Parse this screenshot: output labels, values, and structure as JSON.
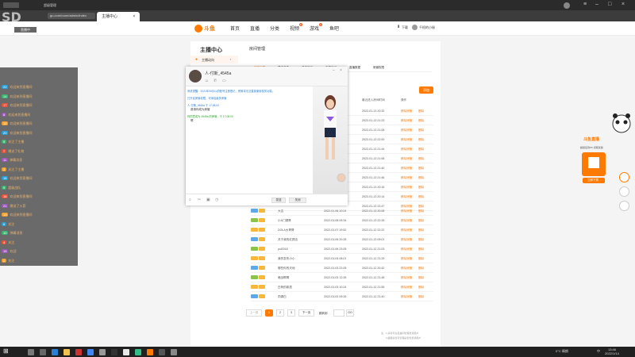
{
  "browser": {
    "tab1": "超级管理",
    "tab2": "主播中心",
    "address": "gu.com/room/admin/index"
  },
  "header": {
    "nav": [
      "首页",
      "直播",
      "分类",
      "视频",
      "游戏",
      "鱼吧"
    ],
    "video_badge": "6",
    "game_badge": "9",
    "download": "下载",
    "user": "千桓的小秘"
  },
  "overlay": {
    "logo": "SD",
    "logo_sub": "直播中",
    "chat": [
      {
        "lv": "22",
        "text": "欢迎来到直播间"
      },
      {
        "lv": "14",
        "text": "欢迎来到直播间"
      },
      {
        "lv": "17",
        "text": "欢迎来到直播间"
      },
      {
        "lv": "8",
        "text": "欢迎来到直播间"
      },
      {
        "lv": "12",
        "text": "欢迎来到直播间"
      },
      {
        "lv": "20",
        "text": "欢迎来到直播间"
      },
      {
        "lv": "5",
        "text": "关注了主播"
      },
      {
        "lv": "7",
        "text": "赠送了礼物"
      },
      {
        "lv": "11",
        "text": "弹幕消息"
      },
      {
        "lv": "3",
        "text": "关注了主播"
      },
      {
        "lv": "18",
        "text": "欢迎来到直播间"
      },
      {
        "lv": "9",
        "text": "超级战队"
      },
      {
        "lv": "16",
        "text": "欢迎来到直播间"
      },
      {
        "lv": "21",
        "text": "赠送了火箭"
      },
      {
        "lv": "13",
        "text": "欢迎来到直播间"
      },
      {
        "lv": "6",
        "text": "关注"
      },
      {
        "lv": "10",
        "text": "弹幕消息"
      },
      {
        "lv": "4",
        "text": "关注"
      },
      {
        "lv": "15",
        "text": "欢迎"
      },
      {
        "lv": "2",
        "text": "关注"
      }
    ]
  },
  "sidebar": {
    "title": "主播中心",
    "item1": "主播动向",
    "items": [
      "房间管理",
      "直播设置",
      "数据中心",
      "收益管理"
    ]
  },
  "content": {
    "title": "房间管理",
    "tabs": [
      "房管设置",
      "禁言名单",
      "关注房间",
      "主播日记",
      "直播数据",
      "房管权限",
      "弹幕热词"
    ],
    "action_button": "添加",
    "col_time": "最近进入房间时间",
    "col_op": "操作",
    "btn_set": "移除房管",
    "btn_del": "删除",
    "rows": [
      {
        "name": "大吉",
        "time1": "2022-01-06 10:24",
        "time2": "2022-01-13 20:06"
      },
      {
        "name": "小A门源哥",
        "time1": "2022-01-08 09:34",
        "time2": "2022-01-13 22:26"
      },
      {
        "name": "DOLA大哥哥",
        "time1": "2022-01-07 19:52",
        "time2": "2022-01-12 22:22"
      },
      {
        "name": "关于我的红颜法",
        "time1": "2022-01-06 20:28",
        "time2": "2022-01-13 09:01"
      },
      {
        "name": "yul2018",
        "time1": "2022-01-06 23:05",
        "time2": "2022-01-12 21:03"
      },
      {
        "name": "我的发布小小",
        "time1": "2022-01-04 08:01",
        "time2": "2022-01-12 21:29"
      },
      {
        "name": "哪些你的天地",
        "time1": "2022-01-03 22:05",
        "time2": "2022-01-12 20:42"
      },
      {
        "name": "暗战啊啊",
        "time1": "2022-01-03 12:35",
        "time2": "2022-01-12 21:48"
      },
      {
        "name": "白驹的新居",
        "time1": "2022-01-03 10:24",
        "time2": "2022-01-12 21:55"
      },
      {
        "name": "同源白",
        "time1": "2022-01-02 09:26",
        "time2": "2022-01-12 21:40"
      }
    ],
    "upper_times": [
      "2022-01-13 20:32",
      "2022-01-13 21:23",
      "2022-01-13 21:08",
      "2022-01-13 22:00",
      "2022-01-13 21:44",
      "2022-01-13 21:06",
      "2022-01-13 21:40",
      "2022-01-13 21:46",
      "2022-01-13 20:16",
      "2022-01-13 20:14",
      "2022-01-13 22:47"
    ],
    "pagination": [
      "上一页",
      "1",
      "2",
      "3",
      "下一页"
    ],
    "jump_label": "跳转到",
    "jump_button": "GO",
    "footnote1": "注：1.房管可在直播间管理普通用户",
    "footnote2": "2.超级房管可管理房管和普通用户"
  },
  "imwindow": {
    "name": "人-付斯_4545a",
    "sys1": "系统提醒：2021年06月以前账号注册登记，房管将无法直接使用相关功能。",
    "sys2": "已开启房管权限，可添加最多房管",
    "line1": "人-付斯_4545a 于 17:08:00",
    "line2": "邀请你成为房管",
    "line3": "你同意成为 4545a 的房管，于 17:08:00",
    "line4": "嗯",
    "send": "发送",
    "close": "关闭"
  },
  "ad": {
    "brand": "斗鱼直播",
    "tagline": "超级签到PK,领取奖励",
    "cta": "立即下载"
  },
  "taskbar": {
    "temp": "0°C 晴朗",
    "lang": "中",
    "time": "13:46",
    "date": "2022/1/14"
  }
}
